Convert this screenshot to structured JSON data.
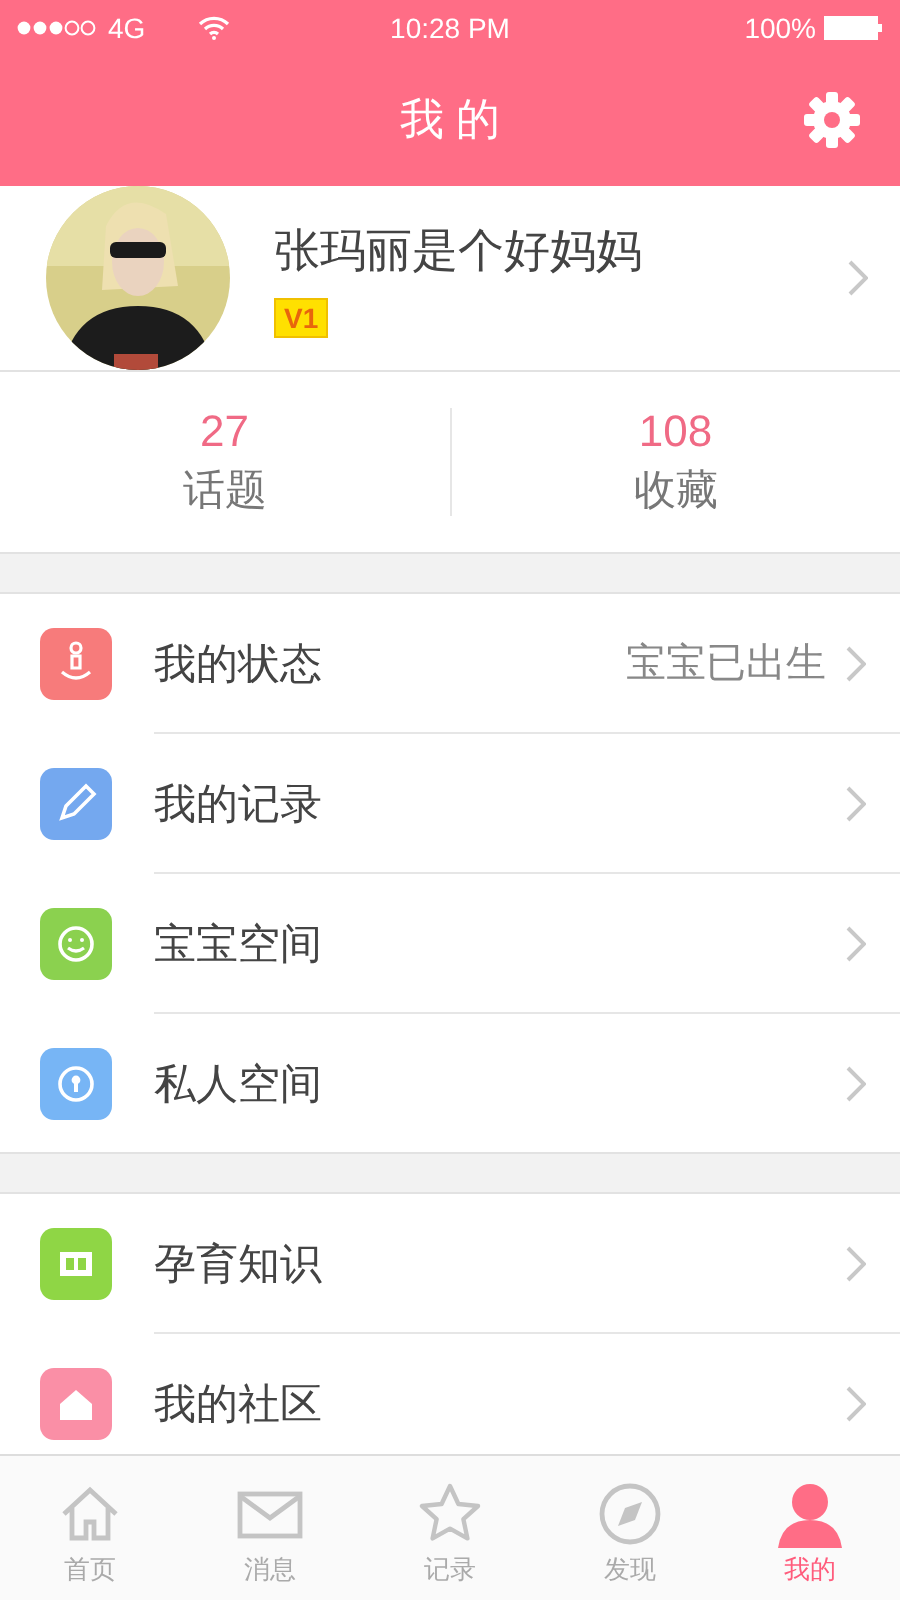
{
  "status_bar": {
    "network": "4G",
    "time": "10:28 PM",
    "battery": "100%"
  },
  "nav_bar": {
    "title": "我 的"
  },
  "profile": {
    "name": "张玛丽是个好妈妈",
    "level": "V1"
  },
  "stats": [
    {
      "value": "27",
      "label": "话题"
    },
    {
      "value": "108",
      "label": "收藏"
    }
  ],
  "menu_groups": [
    {
      "items": [
        {
          "label": "我的状态",
          "detail": "宝宝已出生",
          "color": "#f77b7b"
        },
        {
          "label": "我的记录",
          "color": "#74a8ef"
        },
        {
          "label": "宝宝空间",
          "color": "#8bd14f"
        },
        {
          "label": "私人空间",
          "color": "#77b5f5"
        }
      ]
    },
    {
      "items": [
        {
          "label": "孕育知识",
          "color": "#8fd645"
        },
        {
          "label": "我的社区",
          "color": "#fa8fa6"
        }
      ]
    }
  ],
  "tab_bar": [
    {
      "label": "首页",
      "selected": false
    },
    {
      "label": "消息",
      "selected": false
    },
    {
      "label": "记录",
      "selected": false
    },
    {
      "label": "发现",
      "selected": false
    },
    {
      "label": "我的",
      "selected": true
    }
  ]
}
